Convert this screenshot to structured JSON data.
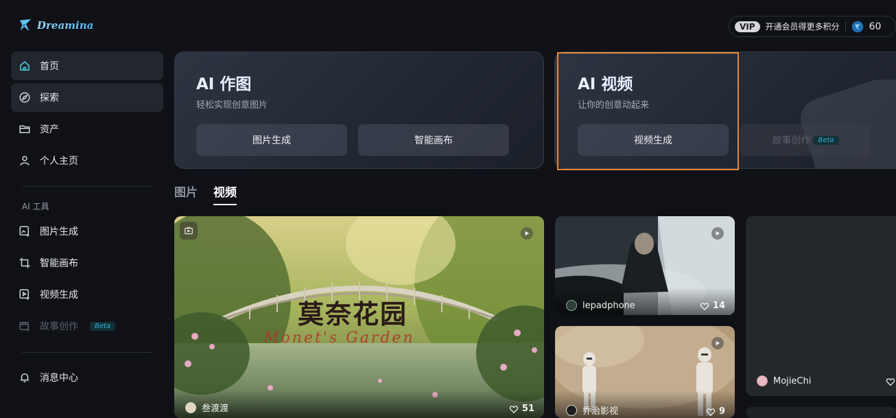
{
  "brand": {
    "name": "Dreamina"
  },
  "sidebar": {
    "nav": [
      {
        "label": "首页",
        "icon": "home-icon"
      },
      {
        "label": "探索",
        "icon": "compass-icon"
      },
      {
        "label": "资产",
        "icon": "folder-icon"
      },
      {
        "label": "个人主页",
        "icon": "user-icon"
      }
    ],
    "section_label": "AI 工具",
    "tools": [
      {
        "label": "图片生成",
        "icon": "image-generate-icon"
      },
      {
        "label": "智能画布",
        "icon": "canvas-crop-icon"
      },
      {
        "label": "视频生成",
        "icon": "video-generate-icon"
      },
      {
        "label": "故事创作",
        "icon": "story-icon",
        "badge": "Beta"
      }
    ],
    "notifications": {
      "label": "消息中心",
      "icon": "bell-icon"
    }
  },
  "topbar": {
    "vip_label": "VIP",
    "vip_text": "开通会员得更多积分",
    "credits": "60"
  },
  "features": [
    {
      "title": "AI 作图",
      "subtitle": "轻松实现创意图片",
      "buttons": [
        "图片生成",
        "智能画布"
      ]
    },
    {
      "title": "AI 视频",
      "subtitle": "让你的创意动起来",
      "buttons": [
        "视频生成"
      ],
      "extra_button": {
        "label": "故事创作",
        "badge": "Beta"
      }
    }
  ],
  "tabs": [
    "图片",
    "视频"
  ],
  "gallery": [
    {
      "author": "叁渡渡",
      "likes": "51",
      "overlay_title": "莫奈花园",
      "overlay_script": "Monet's Garden"
    },
    {
      "author": "lepadphone",
      "likes": "14"
    },
    {
      "author": "乔治影视",
      "likes": "9"
    },
    {
      "author": "MojieChi",
      "likes": ""
    }
  ],
  "colors": {
    "accent": "#2fb6d7",
    "highlight_border": "#e8893a",
    "background": "#0f1116"
  }
}
